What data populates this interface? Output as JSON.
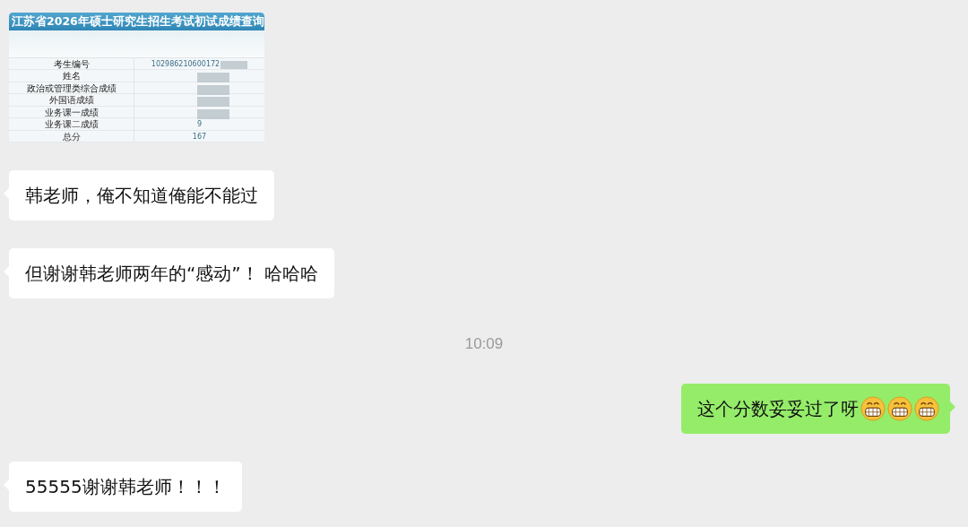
{
  "messages": [
    {
      "kind": "image",
      "card": {
        "title": "江苏省2026年硕士研究生招生考试初试成绩查询",
        "rows": [
          {
            "label": "考生编号",
            "value": "102986210600172",
            "masked": true
          },
          {
            "label": "姓名",
            "masked": true
          },
          {
            "label": "政治或管理类综合成绩",
            "masked": true
          },
          {
            "label": "外国语成绩",
            "masked": true
          },
          {
            "label": "业务课一成绩",
            "masked": true
          },
          {
            "label": "业务课二成绩",
            "value": "9",
            "masked": false
          },
          {
            "label": "总分",
            "value": "167",
            "masked": false
          }
        ]
      }
    },
    {
      "kind": "incoming",
      "text": "韩老师，俺不知道俺能不能过"
    },
    {
      "kind": "incoming",
      "text": "但谢谢韩老师两年的“感动”！ 哈哈哈"
    },
    {
      "kind": "time",
      "text": "10:09"
    },
    {
      "kind": "outgoing",
      "text": "这个分数妥妥过了呀",
      "emojis": [
        {
          "kind": "grin"
        },
        {
          "kind": "grin"
        },
        {
          "kind": "grin"
        }
      ]
    },
    {
      "kind": "incoming",
      "text": "55555谢谢韩老师！！！"
    }
  ]
}
